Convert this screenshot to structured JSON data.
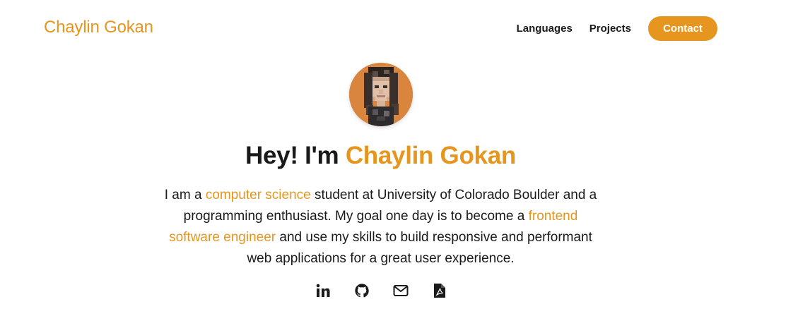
{
  "header": {
    "brand": "Chaylin Gokan",
    "nav": {
      "languages": "Languages",
      "projects": "Projects",
      "contact": "Contact"
    }
  },
  "hero": {
    "greeting": "Hey! I'm",
    "name": "Chaylin Gokan",
    "bio": {
      "part1": "I am a ",
      "highlight1": "computer science",
      "part2": " student at University of Colorado Boulder and a programming enthusiast. My goal one day is to become a ",
      "highlight2": "frontend software engineer",
      "part3": " and use my skills to build responsive and performant web applications for a great user experience."
    }
  },
  "socials": {
    "icons": [
      "linkedin-icon",
      "github-icon",
      "envelope-icon",
      "pdf-file-icon"
    ],
    "linkedin_glyph": "in"
  },
  "colors": {
    "accent": "#e6961e",
    "text": "#1a1a1a",
    "background": "#ffffff"
  }
}
